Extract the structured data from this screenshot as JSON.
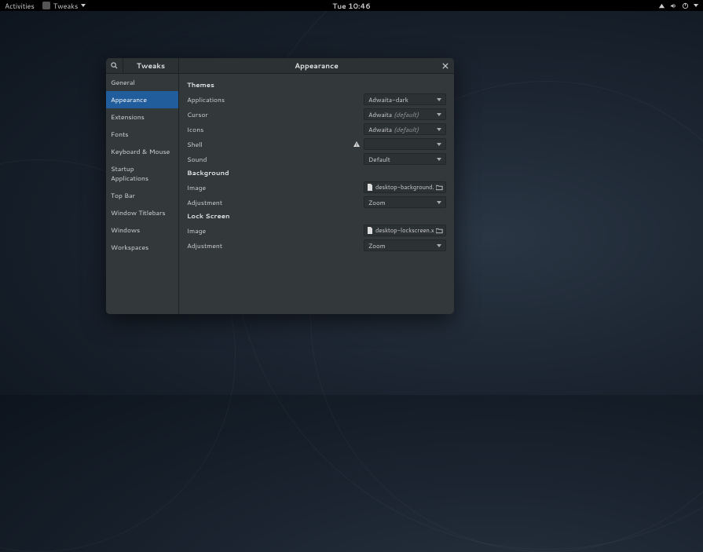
{
  "topbar": {
    "activities": "Activities",
    "app_name": "Tweaks",
    "clock": "Tue 10:46"
  },
  "window": {
    "sidebar_title": "Tweaks",
    "content_title": "Appearance"
  },
  "sidebar": {
    "items": [
      {
        "label": "General"
      },
      {
        "label": "Appearance"
      },
      {
        "label": "Extensions"
      },
      {
        "label": "Fonts"
      },
      {
        "label": "Keyboard & Mouse"
      },
      {
        "label": "Startup Applications"
      },
      {
        "label": "Top Bar"
      },
      {
        "label": "Window Titlebars"
      },
      {
        "label": "Windows"
      },
      {
        "label": "Workspaces"
      }
    ]
  },
  "themes": {
    "header": "Themes",
    "applications": {
      "label": "Applications",
      "value": "Adwaita-dark"
    },
    "cursor": {
      "label": "Cursor",
      "value": "Adwaita",
      "default_suffix": "(default)"
    },
    "icons": {
      "label": "Icons",
      "value": "Adwaita",
      "default_suffix": "(default)"
    },
    "shell": {
      "label": "Shell",
      "value": ""
    },
    "sound": {
      "label": "Sound",
      "value": "Default"
    }
  },
  "background": {
    "header": "Background",
    "image": {
      "label": "Image",
      "value": "desktop-background.xml"
    },
    "adjustment": {
      "label": "Adjustment",
      "value": "Zoom"
    }
  },
  "lockscreen": {
    "header": "Lock Screen",
    "image": {
      "label": "Image",
      "value": "desktop-lockscreen.xml"
    },
    "adjustment": {
      "label": "Adjustment",
      "value": "Zoom"
    }
  }
}
